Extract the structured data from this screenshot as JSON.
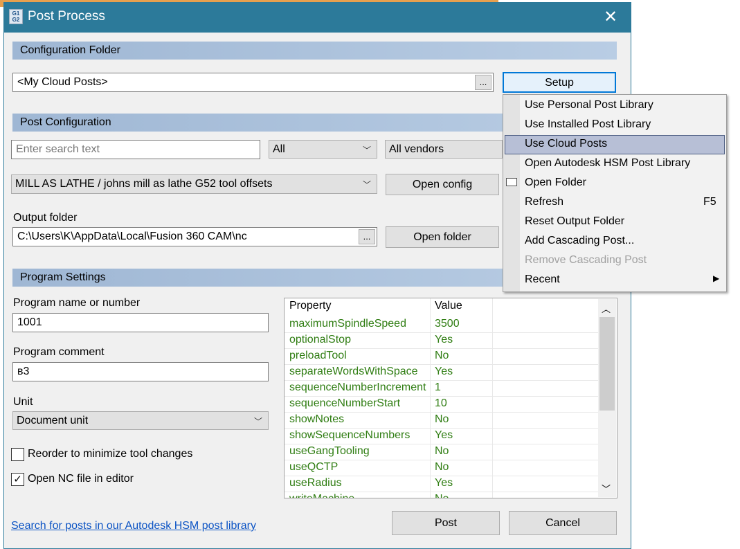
{
  "window": {
    "title": "Post Process",
    "icon": "G1G2",
    "close": "✕"
  },
  "config_folder": {
    "header": "Configuration Folder",
    "value": "<My Cloud Posts>",
    "browse": "...",
    "setup": "Setup"
  },
  "post_config": {
    "header": "Post Configuration",
    "search_placeholder": "Enter search text",
    "filter": "All",
    "vendor": "All vendors",
    "post": "MILL AS LATHE / johns mill as lathe G52 tool offsets",
    "open_config": "Open config"
  },
  "output": {
    "label": "Output folder",
    "value": "C:\\Users\\K\\AppData\\Local\\Fusion 360 CAM\\nc",
    "browse": "...",
    "open_folder": "Open folder"
  },
  "program": {
    "header": "Program Settings",
    "name_label": "Program name or number",
    "name": "1001",
    "comment_label": "Program comment",
    "comment": "в3",
    "unit_label": "Unit",
    "unit": "Document unit",
    "reorder": "Reorder to minimize tool changes",
    "reorder_checked": false,
    "open_nc": "Open NC file in editor",
    "open_nc_checked": true
  },
  "properties": {
    "headers": [
      "Property",
      "Value"
    ],
    "rows": [
      [
        "maximumSpindleSpeed",
        "3500"
      ],
      [
        "optionalStop",
        "Yes"
      ],
      [
        "preloadTool",
        "No"
      ],
      [
        "separateWordsWithSpace",
        "Yes"
      ],
      [
        "sequenceNumberIncrement",
        "1"
      ],
      [
        "sequenceNumberStart",
        "10"
      ],
      [
        "showNotes",
        "No"
      ],
      [
        "showSequenceNumbers",
        "Yes"
      ],
      [
        "useGangTooling",
        "No"
      ],
      [
        "useQCTP",
        "No"
      ],
      [
        "useRadius",
        "Yes"
      ],
      [
        "writeMachine",
        "No"
      ]
    ]
  },
  "menu": {
    "items": [
      {
        "label": "Use Personal Post Library"
      },
      {
        "label": "Use Installed Post Library"
      },
      {
        "label": "Use Cloud Posts",
        "highlighted": true
      },
      {
        "label": "Open Autodesk HSM Post Library"
      },
      {
        "label": "Open Folder",
        "icon": "folder-icon"
      },
      {
        "label": "Refresh",
        "shortcut": "F5"
      },
      {
        "label": "Reset Output Folder"
      },
      {
        "label": "Add Cascading Post..."
      },
      {
        "label": "Remove Cascading Post",
        "disabled": true
      },
      {
        "label": "Recent",
        "submenu": true
      }
    ]
  },
  "footer": {
    "link": "Search for posts in our Autodesk HSM post library",
    "post": "Post",
    "cancel": "Cancel"
  }
}
